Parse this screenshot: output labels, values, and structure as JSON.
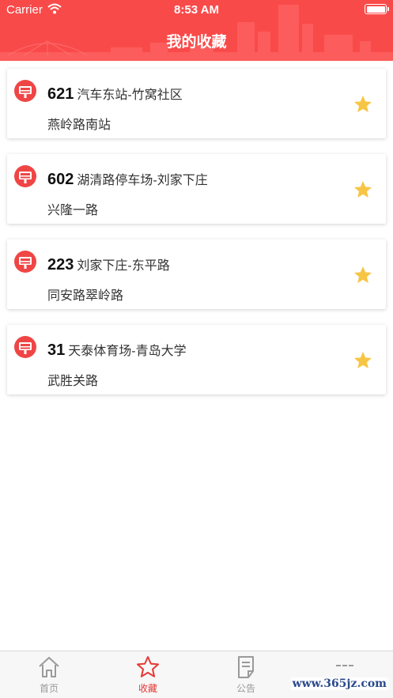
{
  "status_bar": {
    "carrier": "Carrier",
    "time": "8:53 AM"
  },
  "header": {
    "title": "我的收藏"
  },
  "favorites": [
    {
      "route": "621",
      "line": "汽车东站-竹窝社区",
      "stop": "燕岭路南站"
    },
    {
      "route": "602",
      "line": "湖清路停车场-刘家下庄",
      "stop": "兴隆一路"
    },
    {
      "route": "223",
      "line": "刘家下庄-东平路",
      "stop": "同安路翠岭路"
    },
    {
      "route": "31",
      "line": "天泰体育场-青岛大学",
      "stop": "武胜关路"
    }
  ],
  "tabbar": {
    "items": [
      {
        "label": "首页",
        "icon": "home-icon",
        "active": false
      },
      {
        "label": "收藏",
        "icon": "star-outline-icon",
        "active": true
      },
      {
        "label": "公告",
        "icon": "notice-icon",
        "active": false
      },
      {
        "label": "",
        "icon": "more-icon",
        "active": false
      }
    ]
  },
  "watermark": "www.365jz.com",
  "colors": {
    "brand_red": "#f94a4a",
    "star_yellow": "#f7c544",
    "tab_active": "#e53935",
    "tab_inactive": "#999999"
  }
}
